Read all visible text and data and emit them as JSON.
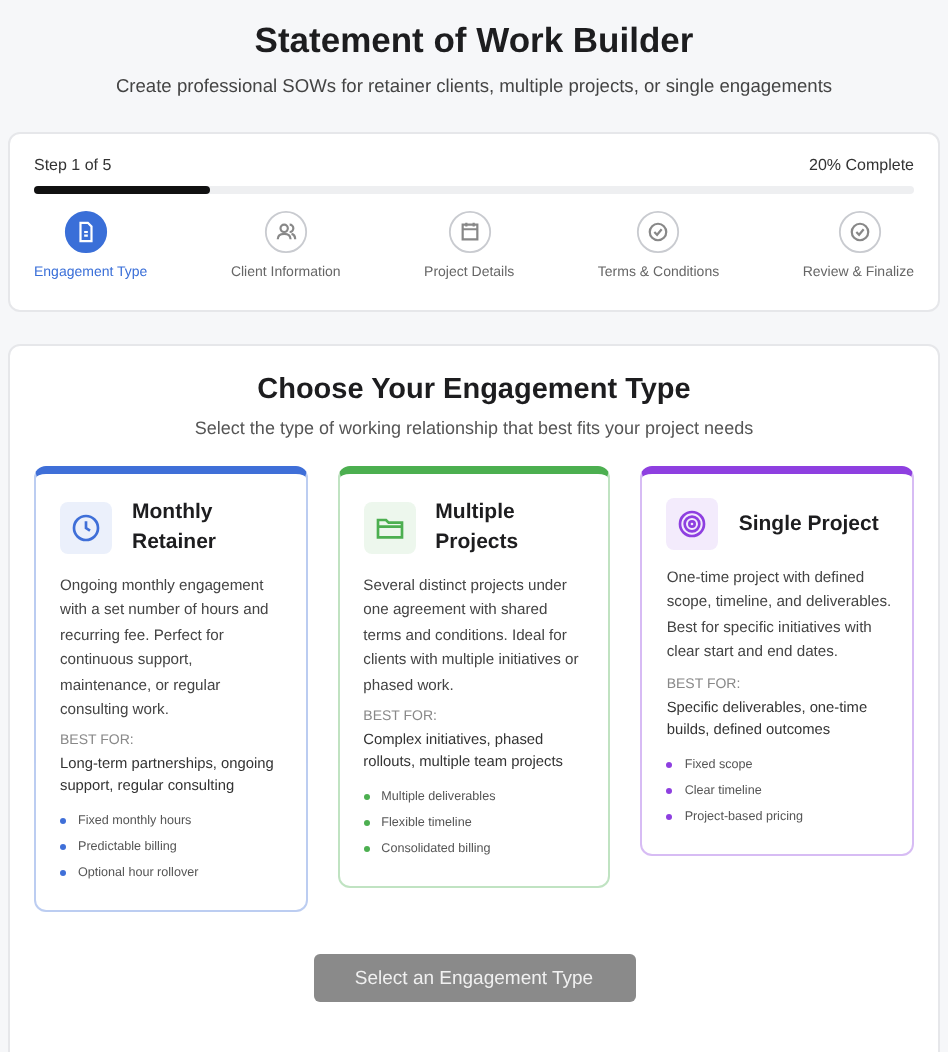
{
  "header": {
    "title": "Statement of Work Builder",
    "subtitle": "Create professional SOWs for retainer clients, multiple projects, or single engagements"
  },
  "progress": {
    "step_label": "Step 1 of 5",
    "percent_label": "20% Complete",
    "level": 0.2
  },
  "steps": [
    {
      "label": "Engagement Type",
      "kind": "document",
      "selected": true
    },
    {
      "label": "Client Information",
      "kind": "people",
      "selected": false
    },
    {
      "label": "Project Details",
      "kind": "calendar",
      "selected": false
    },
    {
      "label": "Terms & Conditions",
      "kind": "check",
      "selected": false
    },
    {
      "label": "Review & Finalize",
      "kind": "check",
      "selected": false
    }
  ],
  "section": {
    "title": "Choose Your Engagement Type",
    "subtitle": "Select the type of working relationship that best fits your project needs"
  },
  "cards": [
    {
      "title": "Monthly Retainer",
      "kind": "clock",
      "color": "#3f6fd8",
      "description": "Ongoing monthly engagement with a set number of hours and recurring fee. Perfect for continuous support, maintenance, or regular consulting work.",
      "best_for_label": "BEST FOR:",
      "best_for": "Long-term partnerships, ongoing support, regular consulting",
      "features": [
        "Fixed monthly hours",
        "Predictable billing",
        "Optional hour rollover"
      ]
    },
    {
      "title": "Multiple Projects",
      "kind": "folder",
      "color": "#4caf50",
      "description": "Several distinct projects under one agreement with shared terms and conditions. Ideal for clients with multiple initiatives or phased work.",
      "best_for_label": "BEST FOR:",
      "best_for": "Complex initiatives, phased rollouts, multiple team projects",
      "features": [
        "Multiple deliverables",
        "Flexible timeline",
        "Consolidated billing"
      ]
    },
    {
      "title": "Single Project",
      "kind": "target",
      "color": "#8e3fe0",
      "description": "One-time project with defined scope, timeline, and deliverables. Best for specific initiatives with clear start and end dates.",
      "best_for_label": "BEST FOR:",
      "best_for": "Specific deliverables, one-time builds, defined outcomes",
      "features": [
        "Fixed scope",
        "Clear timeline",
        "Project-based pricing"
      ]
    }
  ],
  "action": {
    "label": "Select an Engagement Type",
    "disabled": true
  }
}
